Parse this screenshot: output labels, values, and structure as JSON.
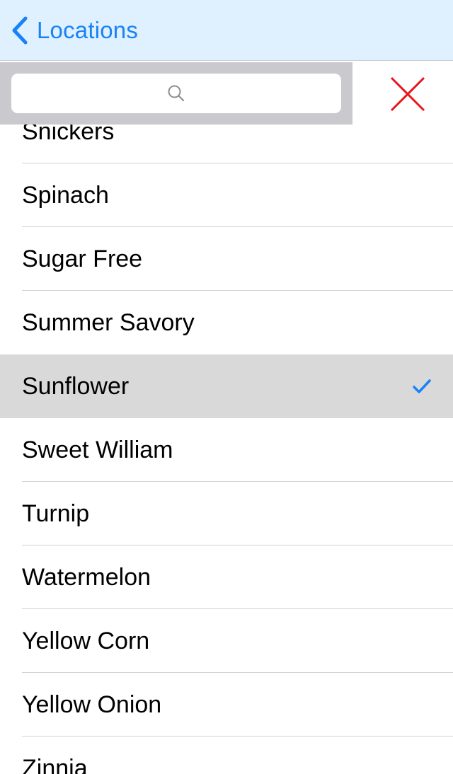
{
  "navbar": {
    "back_label": "Locations",
    "back_icon": "chevron-left-icon"
  },
  "search": {
    "placeholder": "",
    "icon": "search-icon"
  },
  "close": {
    "icon": "close-icon",
    "color": "#e8161b"
  },
  "colors": {
    "accent": "#1a82f7",
    "navbar_bg": "#dff0ff",
    "selected_row_bg": "#d9d9d9",
    "search_bar_bg": "#c9c9ce"
  },
  "list": {
    "items": [
      {
        "label": "Snickers",
        "selected": false
      },
      {
        "label": "Spinach",
        "selected": false
      },
      {
        "label": "Sugar Free",
        "selected": false
      },
      {
        "label": "Summer Savory",
        "selected": false
      },
      {
        "label": "Sunflower",
        "selected": true
      },
      {
        "label": "Sweet William",
        "selected": false
      },
      {
        "label": "Turnip",
        "selected": false
      },
      {
        "label": "Watermelon",
        "selected": false
      },
      {
        "label": "Yellow Corn",
        "selected": false
      },
      {
        "label": "Yellow Onion",
        "selected": false
      },
      {
        "label": "Zinnia",
        "selected": false
      }
    ]
  }
}
